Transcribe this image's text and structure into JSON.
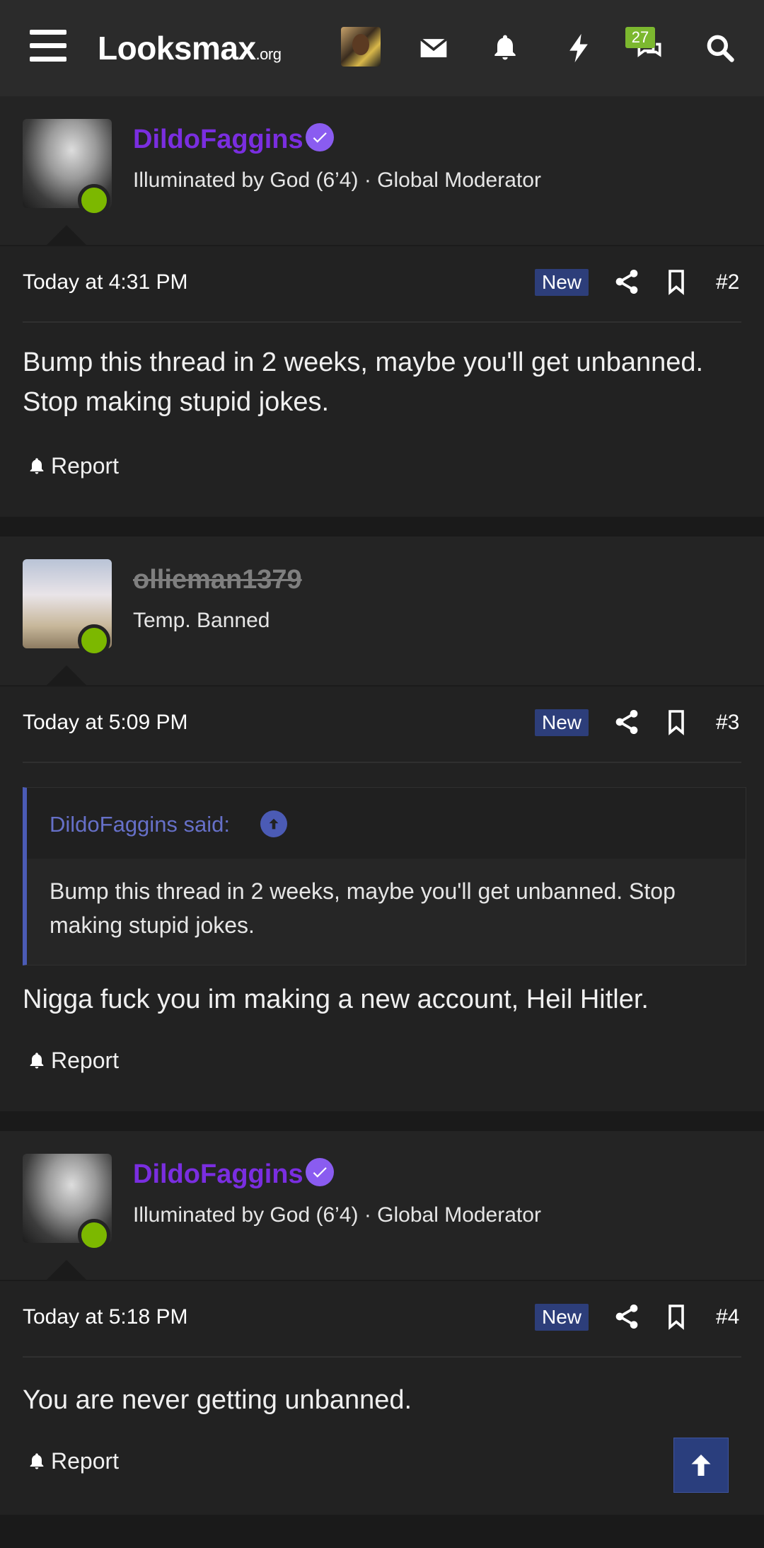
{
  "topbar": {
    "logo_main": "Looksmax",
    "logo_suffix": ".org",
    "chat_badge": "27",
    "icons": [
      "menu-icon",
      "mail-icon",
      "bell-icon",
      "bolt-icon",
      "chat-icon",
      "search-icon"
    ]
  },
  "posts": [
    {
      "username": "DildoFaggins",
      "user_title": "Illuminated by God (6’4) · Global Moderator",
      "date": "Today at 4:31 PM",
      "new_label": "New",
      "post_number": "#2",
      "body": "Bump this thread in 2 weeks, maybe you'll get unbanned. Stop making stupid jokes.",
      "report_label": "Report"
    },
    {
      "username": "ollieman1379",
      "user_title": "Temp. Banned",
      "date": "Today at 5:09 PM",
      "new_label": "New",
      "post_number": "#3",
      "quote": {
        "author": "DildoFaggins said:",
        "text": "Bump this thread in 2 weeks, maybe you'll get unbanned. Stop making stupid jokes."
      },
      "body": "Nigga fuck you im making a new account, Heil Hitler.",
      "report_label": "Report"
    },
    {
      "username": "DildoFaggins",
      "user_title": "Illuminated by God (6’4) · Global Moderator",
      "date": "Today at 5:18 PM",
      "new_label": "New",
      "post_number": "#4",
      "body": "You are never getting unbanned.",
      "report_label": "Report"
    }
  ],
  "colors": {
    "username_mod": "#7a2ee0",
    "online": "#7cb800",
    "new_badge": "#2d3e7a",
    "quote_accent": "#4b5bb5"
  }
}
